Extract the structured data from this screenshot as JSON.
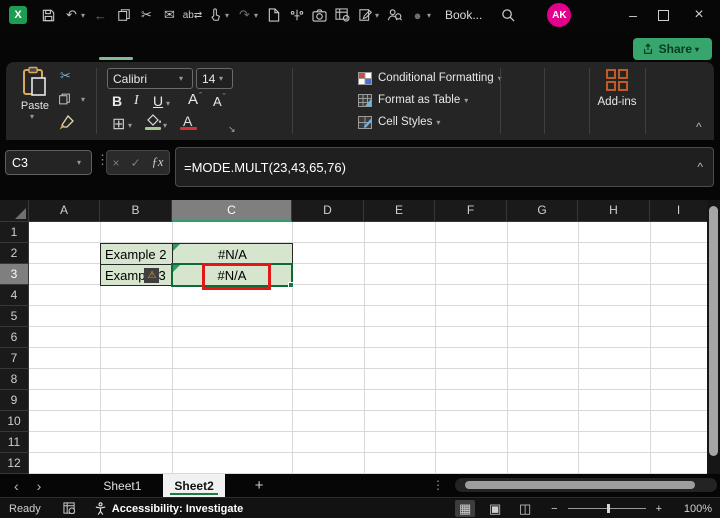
{
  "titlebar": {
    "document_title": "Book...",
    "avatar_initials": "AK"
  },
  "ribbon": {
    "share_label": "Share",
    "paste_label": "Paste",
    "font_name": "Calibri",
    "font_size": "14",
    "bold_label": "B",
    "italic_label": "I",
    "underline_label": "U",
    "grow_font_label": "A",
    "shrink_font_label": "A",
    "font_color_label": "A",
    "conditional_formatting_label": "Conditional Formatting",
    "format_as_table_label": "Format as Table",
    "cell_styles_label": "Cell Styles",
    "addins_label": "Add-ins"
  },
  "formula_bar": {
    "name_box_value": "C3",
    "fx_label": "ƒx",
    "formula": "=MODE.MULT(23,43,65,76)"
  },
  "grid": {
    "columns": [
      "A",
      "B",
      "C",
      "D",
      "E",
      "F",
      "G",
      "H",
      "I"
    ],
    "rows": [
      "1",
      "2",
      "3",
      "4",
      "5",
      "6",
      "7",
      "8",
      "9",
      "10",
      "11",
      "12"
    ],
    "selected_column": "C",
    "selected_row": "3",
    "selected_cell": "C3",
    "cells": {
      "B2": "Example 2",
      "C2": "#N/A",
      "B3": "Example 3",
      "C3": "#N/A"
    },
    "b3_display": {
      "prefix": "Examp",
      "suffix": "3"
    }
  },
  "sheet_tabs": {
    "sheet1_label": "Sheet1",
    "sheet2_label": "Sheet2"
  },
  "status_bar": {
    "ready_label": "Ready",
    "accessibility_label": "Accessibility: Investigate",
    "zoom_level": "100%"
  },
  "icons": {
    "undo": "↶",
    "redo": "↷",
    "back": "←",
    "cut": "✂",
    "email": "✉",
    "find_replace": "ab⇄",
    "record": "●",
    "overflow": "⋮",
    "chevron_down": "▾",
    "collapse_ribbon": "^",
    "expand_formula_bar": "^",
    "cancel": "×",
    "enter": "✓",
    "warning": "⚠",
    "borders": "⊞",
    "prev_sheet": "‹",
    "next_sheet": "›",
    "add_sheet": "+",
    "minimize": "–",
    "close": "×",
    "view_normal": "▦",
    "view_page_layout": "▣",
    "view_page_break": "◫",
    "zoom_out": "−",
    "zoom_in": "+",
    "more_dots": "⋮",
    "grow_caret": "ˆ",
    "shrink_caret": "ˇ"
  },
  "colors": {
    "accent_green": "#107c41",
    "share_green": "#37a66c",
    "cell_fill_green": "#d6e5ce",
    "annotation_red": "#e21717",
    "avatar_pink": "#e3008c",
    "addins_orange": "#c05a28",
    "warning_orange": "#f0a030",
    "tab_indicator_green": "#84bb97"
  }
}
